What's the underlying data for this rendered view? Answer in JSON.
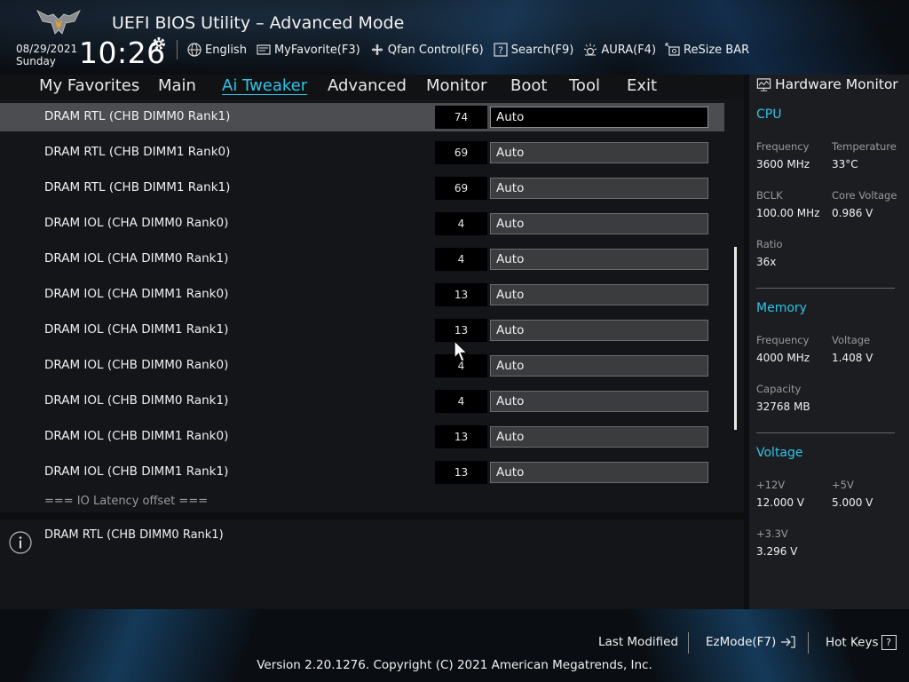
{
  "header": {
    "title": "UEFI BIOS Utility – Advanced Mode",
    "date": "08/29/2021",
    "day": "Sunday",
    "time": "10:26",
    "toolbar": [
      {
        "label": "English",
        "icon": "globe-icon"
      },
      {
        "label": "MyFavorite(F3)",
        "icon": "favorite-icon"
      },
      {
        "label": "Qfan Control(F6)",
        "icon": "fan-icon"
      },
      {
        "label": "Search(F9)",
        "icon": "search-icon"
      },
      {
        "label": "AURA(F4)",
        "icon": "aura-light-icon"
      },
      {
        "label": "ReSize BAR",
        "icon": "resize-bar-icon"
      }
    ]
  },
  "menu": {
    "items": [
      "My Favorites",
      "Main",
      "Ai Tweaker",
      "Advanced",
      "Monitor",
      "Boot",
      "Tool",
      "Exit"
    ],
    "active": "Ai Tweaker"
  },
  "settings": {
    "rows": [
      {
        "label": "DRAM RTL (CHB DIMM0 Rank1)",
        "current": "74",
        "option": "Auto",
        "selected": true
      },
      {
        "label": "DRAM RTL (CHB DIMM1 Rank0)",
        "current": "69",
        "option": "Auto"
      },
      {
        "label": "DRAM RTL (CHB DIMM1 Rank1)",
        "current": "69",
        "option": "Auto"
      },
      {
        "label": "DRAM IOL (CHA DIMM0 Rank0)",
        "current": "4",
        "option": "Auto"
      },
      {
        "label": "DRAM IOL (CHA DIMM0 Rank1)",
        "current": "4",
        "option": "Auto"
      },
      {
        "label": "DRAM IOL (CHA DIMM1 Rank0)",
        "current": "13",
        "option": "Auto"
      },
      {
        "label": "DRAM IOL (CHA DIMM1 Rank1)",
        "current": "13",
        "option": "Auto"
      },
      {
        "label": "DRAM IOL (CHB DIMM0 Rank0)",
        "current": "4",
        "option": "Auto"
      },
      {
        "label": "DRAM IOL (CHB DIMM0 Rank1)",
        "current": "4",
        "option": "Auto"
      },
      {
        "label": "DRAM IOL (CHB DIMM1 Rank0)",
        "current": "13",
        "option": "Auto"
      },
      {
        "label": "DRAM IOL (CHB DIMM1 Rank1)",
        "current": "13",
        "option": "Auto"
      }
    ],
    "section_label": "=== IO Latency offset ==="
  },
  "help": {
    "text": "DRAM RTL (CHB DIMM0 Rank1)"
  },
  "hardware_monitor": {
    "title": "Hardware Monitor",
    "cpu": {
      "heading": "CPU",
      "frequency_label": "Frequency",
      "frequency": "3600 MHz",
      "temperature_label": "Temperature",
      "temperature": "33°C",
      "bclk_label": "BCLK",
      "bclk": "100.00 MHz",
      "core_voltage_label": "Core Voltage",
      "core_voltage": "0.986 V",
      "ratio_label": "Ratio",
      "ratio": "36x"
    },
    "memory": {
      "heading": "Memory",
      "frequency_label": "Frequency",
      "frequency": "4000 MHz",
      "voltage_label": "Voltage",
      "voltage": "1.408 V",
      "capacity_label": "Capacity",
      "capacity": "32768 MB"
    },
    "voltage": {
      "heading": "Voltage",
      "v12_label": "+12V",
      "v12": "12.000 V",
      "v5_label": "+5V",
      "v5": "5.000 V",
      "v33_label": "+3.3V",
      "v33": "3.296 V"
    }
  },
  "footer": {
    "last_modified": "Last Modified",
    "ezmode": "EzMode(F7)",
    "hot_keys": "Hot Keys",
    "hot_keys_key": "?",
    "copyright": "Version 2.20.1276. Copyright (C) 2021 American Megatrends, Inc."
  },
  "colors": {
    "accent": "#30c4e8",
    "selected_row": "#4b4d50",
    "panel": "#131518"
  }
}
